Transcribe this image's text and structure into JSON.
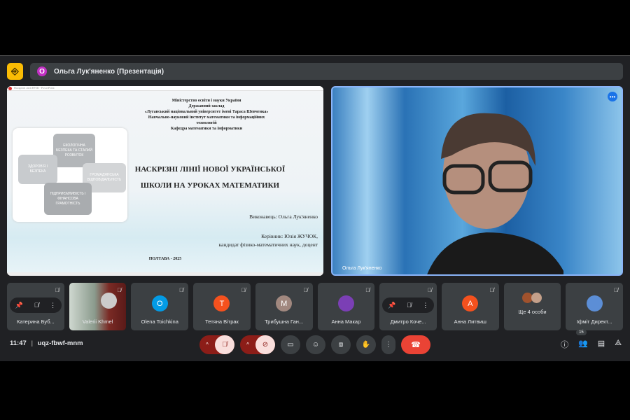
{
  "header": {
    "presenter_initial": "О",
    "presenter_label": "Ольга Лук'яненко (Презентація)"
  },
  "slide": {
    "window_title": "Наскрізні лінії НУШ - PowerPoint",
    "institution": [
      "Міністерство освіти і науки України",
      "Державний заклад",
      "«Луганський національний університет імені Тараса Шевченка»",
      "Навчально-науковий інститут математики та інформаційних",
      "технологій",
      "Кафедра математики та інформатики"
    ],
    "puzzle": [
      "ЕКОЛОГІЧНА БЕЗПЕКА ТА СТАЛИЙ РОЗВИТОК",
      "ЗДОРОВ'Я І БЕЗПЕКА",
      "ГРОМАДЯНСЬКА ВІДПОВІДАЛЬНІСТЬ",
      "ПІДПРИЄМЛИВІСТЬ І ФІНАНСОВА ГРАМОТНІСТЬ"
    ],
    "title_line1": "НАСКРІЗНІ ЛІНІЇ НОВОЇ УКРАЇНСЬКОЇ",
    "title_line2": "ШКОЛИ НА УРОКАХ МАТЕМАТИКИ",
    "author": "Виконавець: Ольга Лук'яненко",
    "supervisor": "Керівник: Юлія ЖУЧОК,",
    "supervisor_title": "кандидат фізико-математичних наук, доцент",
    "city_year": "ПОЛТАВА - 2025"
  },
  "video": {
    "name": "Ольга Лук'яненко"
  },
  "participants": [
    {
      "name": "Катерина Буб...",
      "hover": true
    },
    {
      "name": "Valerii Khmel",
      "video": true
    },
    {
      "name": "Olena Toichkina",
      "initial": "O",
      "color": "#039be5"
    },
    {
      "name": "Тетяна Вітрак",
      "initial": "T",
      "color": "#f4511e"
    },
    {
      "name": "Трибушна Ган...",
      "initial": "M",
      "color": "#a1887f"
    },
    {
      "name": "Анна Макар",
      "initial": "",
      "color": "#7b3fb5"
    },
    {
      "name": "Дмитро Коче...",
      "hover": true
    },
    {
      "name": "Анна Литвиш",
      "initial": "A",
      "color": "#f4511e"
    },
    {
      "name": "Ще 4 особи"
    },
    {
      "name": "Іфміт Директ...",
      "initial": "",
      "color": "#5c8ed6"
    }
  ],
  "bottom": {
    "time": "11:47",
    "separator": "|",
    "meeting_code": "uqz-fbwf-mnm",
    "participants_count": "15"
  }
}
